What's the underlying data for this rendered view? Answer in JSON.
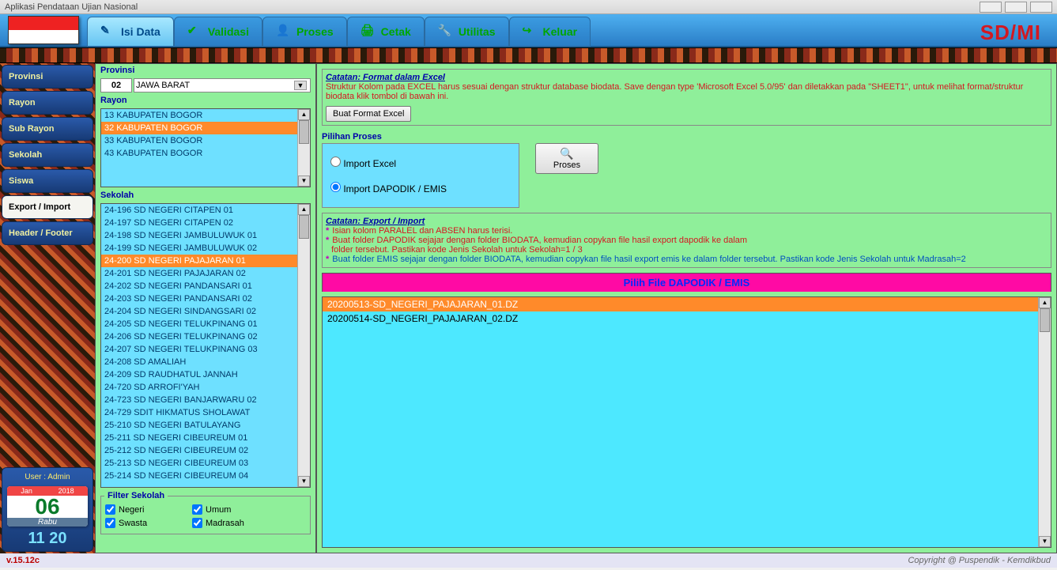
{
  "window": {
    "title": "Aplikasi Pendataan Ujian Nasional"
  },
  "topnav": {
    "tabs": [
      "Isi Data",
      "Validasi",
      "Proses",
      "Cetak",
      "Utilitas",
      "Keluar"
    ],
    "brand": "SD/MI"
  },
  "sidebar": {
    "items": [
      "Provinsi",
      "Rayon",
      "Sub Rayon",
      "Sekolah",
      "Siswa",
      "Export / Import",
      "Header / Footer"
    ],
    "selected_index": 5
  },
  "user": {
    "label": "User : Admin",
    "month": "Jan",
    "year": "2018",
    "day": "06",
    "dow": "Rabu",
    "hour": "11",
    "min": "20"
  },
  "mid": {
    "provinsi_label": "Provinsi",
    "provinsi_code": "02",
    "provinsi_name": "JAWA BARAT",
    "rayon_label": "Rayon",
    "rayon_items": [
      "13  KABUPATEN BOGOR",
      "32  KABUPATEN BOGOR",
      "33  KABUPATEN BOGOR",
      "43  KABUPATEN BOGOR"
    ],
    "rayon_selected": 1,
    "sekolah_label": "Sekolah",
    "sekolah_items": [
      "24-196  SD NEGERI CITAPEN 01",
      "24-197  SD NEGERI CITAPEN 02",
      "24-198  SD NEGERI JAMBULUWUK 01",
      "24-199  SD NEGERI JAMBULUWUK 02",
      "24-200  SD NEGERI PAJAJARAN 01",
      "24-201  SD NEGERI PAJAJARAN 02",
      "24-202  SD NEGERI PANDANSARI 01",
      "24-203  SD NEGERI PANDANSARI 02",
      "24-204  SD NEGERI SINDANGSARI 02",
      "24-205  SD NEGERI TELUKPINANG 01",
      "24-206  SD NEGERI TELUKPINANG 02",
      "24-207  SD NEGERI TELUKPINANG 03",
      "24-208  SD AMALIAH",
      "24-209  SD RAUDHATUL JANNAH",
      "24-720  SD ARROFI'YAH",
      "24-723  SD NEGERI BANJARWARU 02",
      "24-729  SDIT HIKMATUS SHOLAWAT",
      "25-210  SD NEGERI BATULAYANG",
      "25-211  SD NEGERI CIBEUREUM 01",
      "25-212  SD NEGERI CIBEUREUM 02",
      "25-213  SD NEGERI CIBEUREUM 03",
      "25-214  SD NEGERI CIBEUREUM 04"
    ],
    "sekolah_selected": 4,
    "filter_label": "Filter Sekolah",
    "filters": [
      "Negeri",
      "Umum",
      "Swasta",
      "Madrasah"
    ]
  },
  "right": {
    "catatan1_title": "Catatan: Format dalam Excel",
    "catatan1_text": "Struktur Kolom pada EXCEL harus sesuai dengan struktur database biodata. Save dengan type 'Microsoft Excel 5.0/95' dan diletakkan pada \"SHEET1\", untuk melihat format/struktur biodata klik tombol di bawah ini.",
    "btn_format": "Buat Format Excel",
    "pilihan_label": "Pilihan Proses",
    "radio1": "Import Excel",
    "radio2": "Import DAPODIK / EMIS",
    "btn_proses": "Proses",
    "catatan2_title": "Catatan: Export / Import",
    "note1": "Isian kolom PARALEL dan ABSEN harus terisi.",
    "note2a": "Buat folder DAPODIK sejajar dengan folder BIODATA, kemudian copykan file hasil export dapodik ke dalam",
    "note2b": "folder tersebut. Pastikan kode Jenis Sekolah untuk Sekolah=1 / 3",
    "note3": "Buat folder EMIS sejajar dengan folder BIODATA, kemudian copykan file hasil export emis ke dalam folder tersebut. Pastikan kode Jenis Sekolah untuk Madrasah=2",
    "file_header": "Pilih File DAPODIK / EMIS",
    "files": [
      "20200513-SD_NEGERI_PAJAJARAN_01.DZ",
      "20200514-SD_NEGERI_PAJAJARAN_02.DZ"
    ],
    "file_selected": 0
  },
  "footer": {
    "version": "v.15.12c",
    "copyright": "Copyright @ Puspendik - Kemdikbud"
  }
}
